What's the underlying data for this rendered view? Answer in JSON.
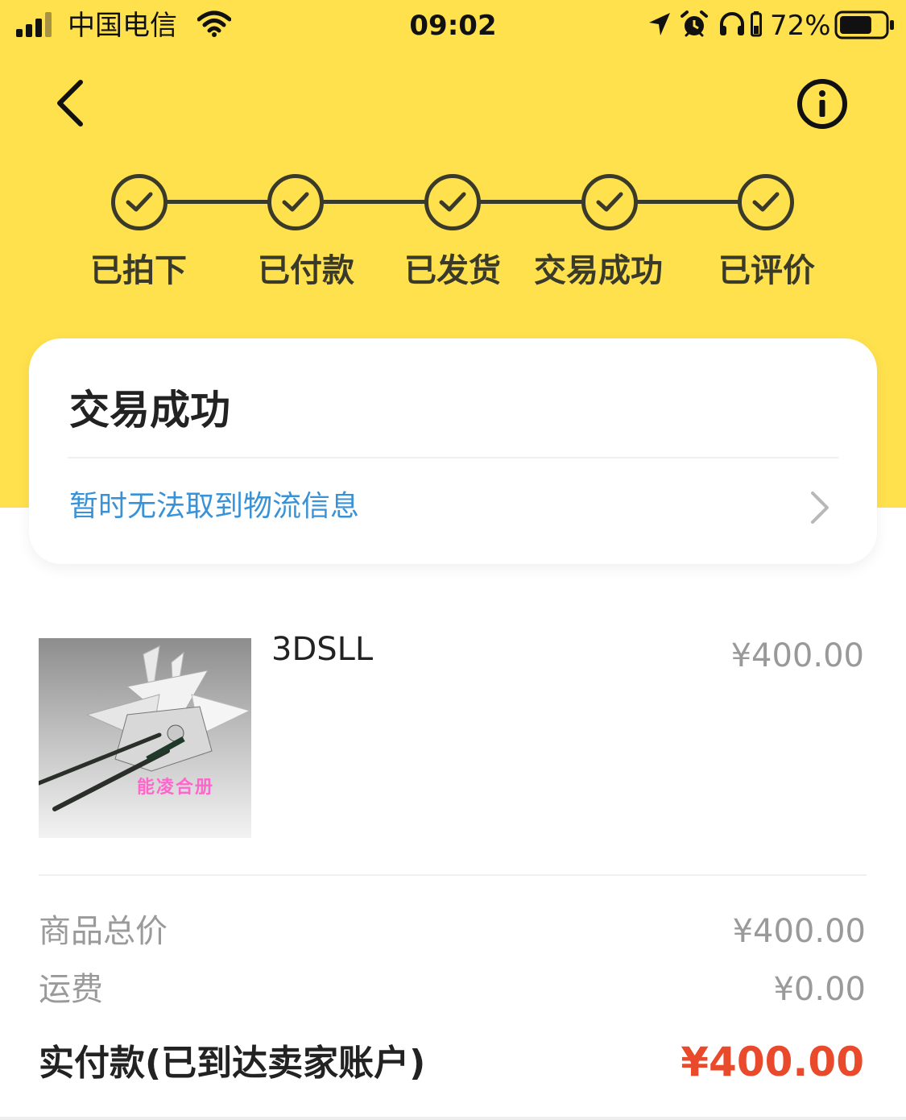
{
  "status_bar": {
    "carrier": "中国电信",
    "time": "09:02",
    "battery_percent": "72%",
    "battery_level": 0.72
  },
  "colors": {
    "header_yellow": "#ffe14d",
    "step_dark": "#3a3a2a",
    "link_blue": "#3a92d6",
    "price_red": "#e84a2b"
  },
  "nav": {
    "back_icon": "chevron-left-icon",
    "info_icon": "info-circle-icon"
  },
  "steps": [
    {
      "label": "已拍下",
      "done": true
    },
    {
      "label": "已付款",
      "done": true
    },
    {
      "label": "已发货",
      "done": true
    },
    {
      "label": "交易成功",
      "done": true
    },
    {
      "label": "已评价",
      "done": true
    }
  ],
  "status_card": {
    "title": "交易成功",
    "logistics_text": "暂时无法取到物流信息"
  },
  "product": {
    "title": "3DSLL",
    "price": "¥400.00",
    "image_caption": "能凌合册"
  },
  "summary": {
    "goods_total_label": "商品总价",
    "goods_total_value": "¥400.00",
    "shipping_label": "运费",
    "shipping_value": "¥0.00",
    "paid_label": "实付款(已到达卖家账户)",
    "paid_value": "¥400.00"
  }
}
